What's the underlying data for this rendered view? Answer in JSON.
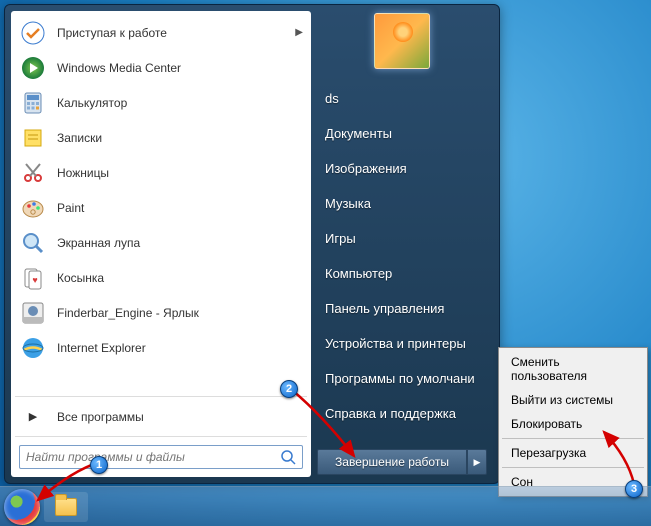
{
  "programs": [
    {
      "label": "Приступая к работе",
      "has_arrow": true,
      "icon": "getting-started"
    },
    {
      "label": "Windows Media Center",
      "icon": "media-center"
    },
    {
      "label": "Калькулятор",
      "icon": "calculator"
    },
    {
      "label": "Записки",
      "icon": "sticky-notes"
    },
    {
      "label": "Ножницы",
      "icon": "snipping"
    },
    {
      "label": "Paint",
      "icon": "paint"
    },
    {
      "label": "Экранная лупа",
      "icon": "magnifier"
    },
    {
      "label": "Косынка",
      "icon": "solitaire"
    },
    {
      "label": "Finderbar_Engine - Ярлык",
      "icon": "finderbar"
    },
    {
      "label": "Internet Explorer",
      "icon": "ie"
    }
  ],
  "all_programs": "Все программы",
  "search": {
    "placeholder": "Найти программы и файлы"
  },
  "right_items": [
    "ds",
    "Документы",
    "Изображения",
    "Музыка",
    "Игры",
    "Компьютер",
    "Панель управления",
    "Устройства и принтеры",
    "Программы по умолчани",
    "Справка и поддержка"
  ],
  "shutdown": {
    "label": "Завершение работы"
  },
  "power_menu": [
    "Сменить пользователя",
    "Выйти из системы",
    "Блокировать",
    "Перезагрузка",
    "Сон"
  ],
  "power_menu_div_after": [
    2,
    3
  ],
  "annotations": {
    "b1": "1",
    "b2": "2",
    "b3": "3"
  },
  "colors": {
    "accent": "#1a7fc4",
    "badge": "#0a63c9",
    "arrow": "#d40000"
  }
}
